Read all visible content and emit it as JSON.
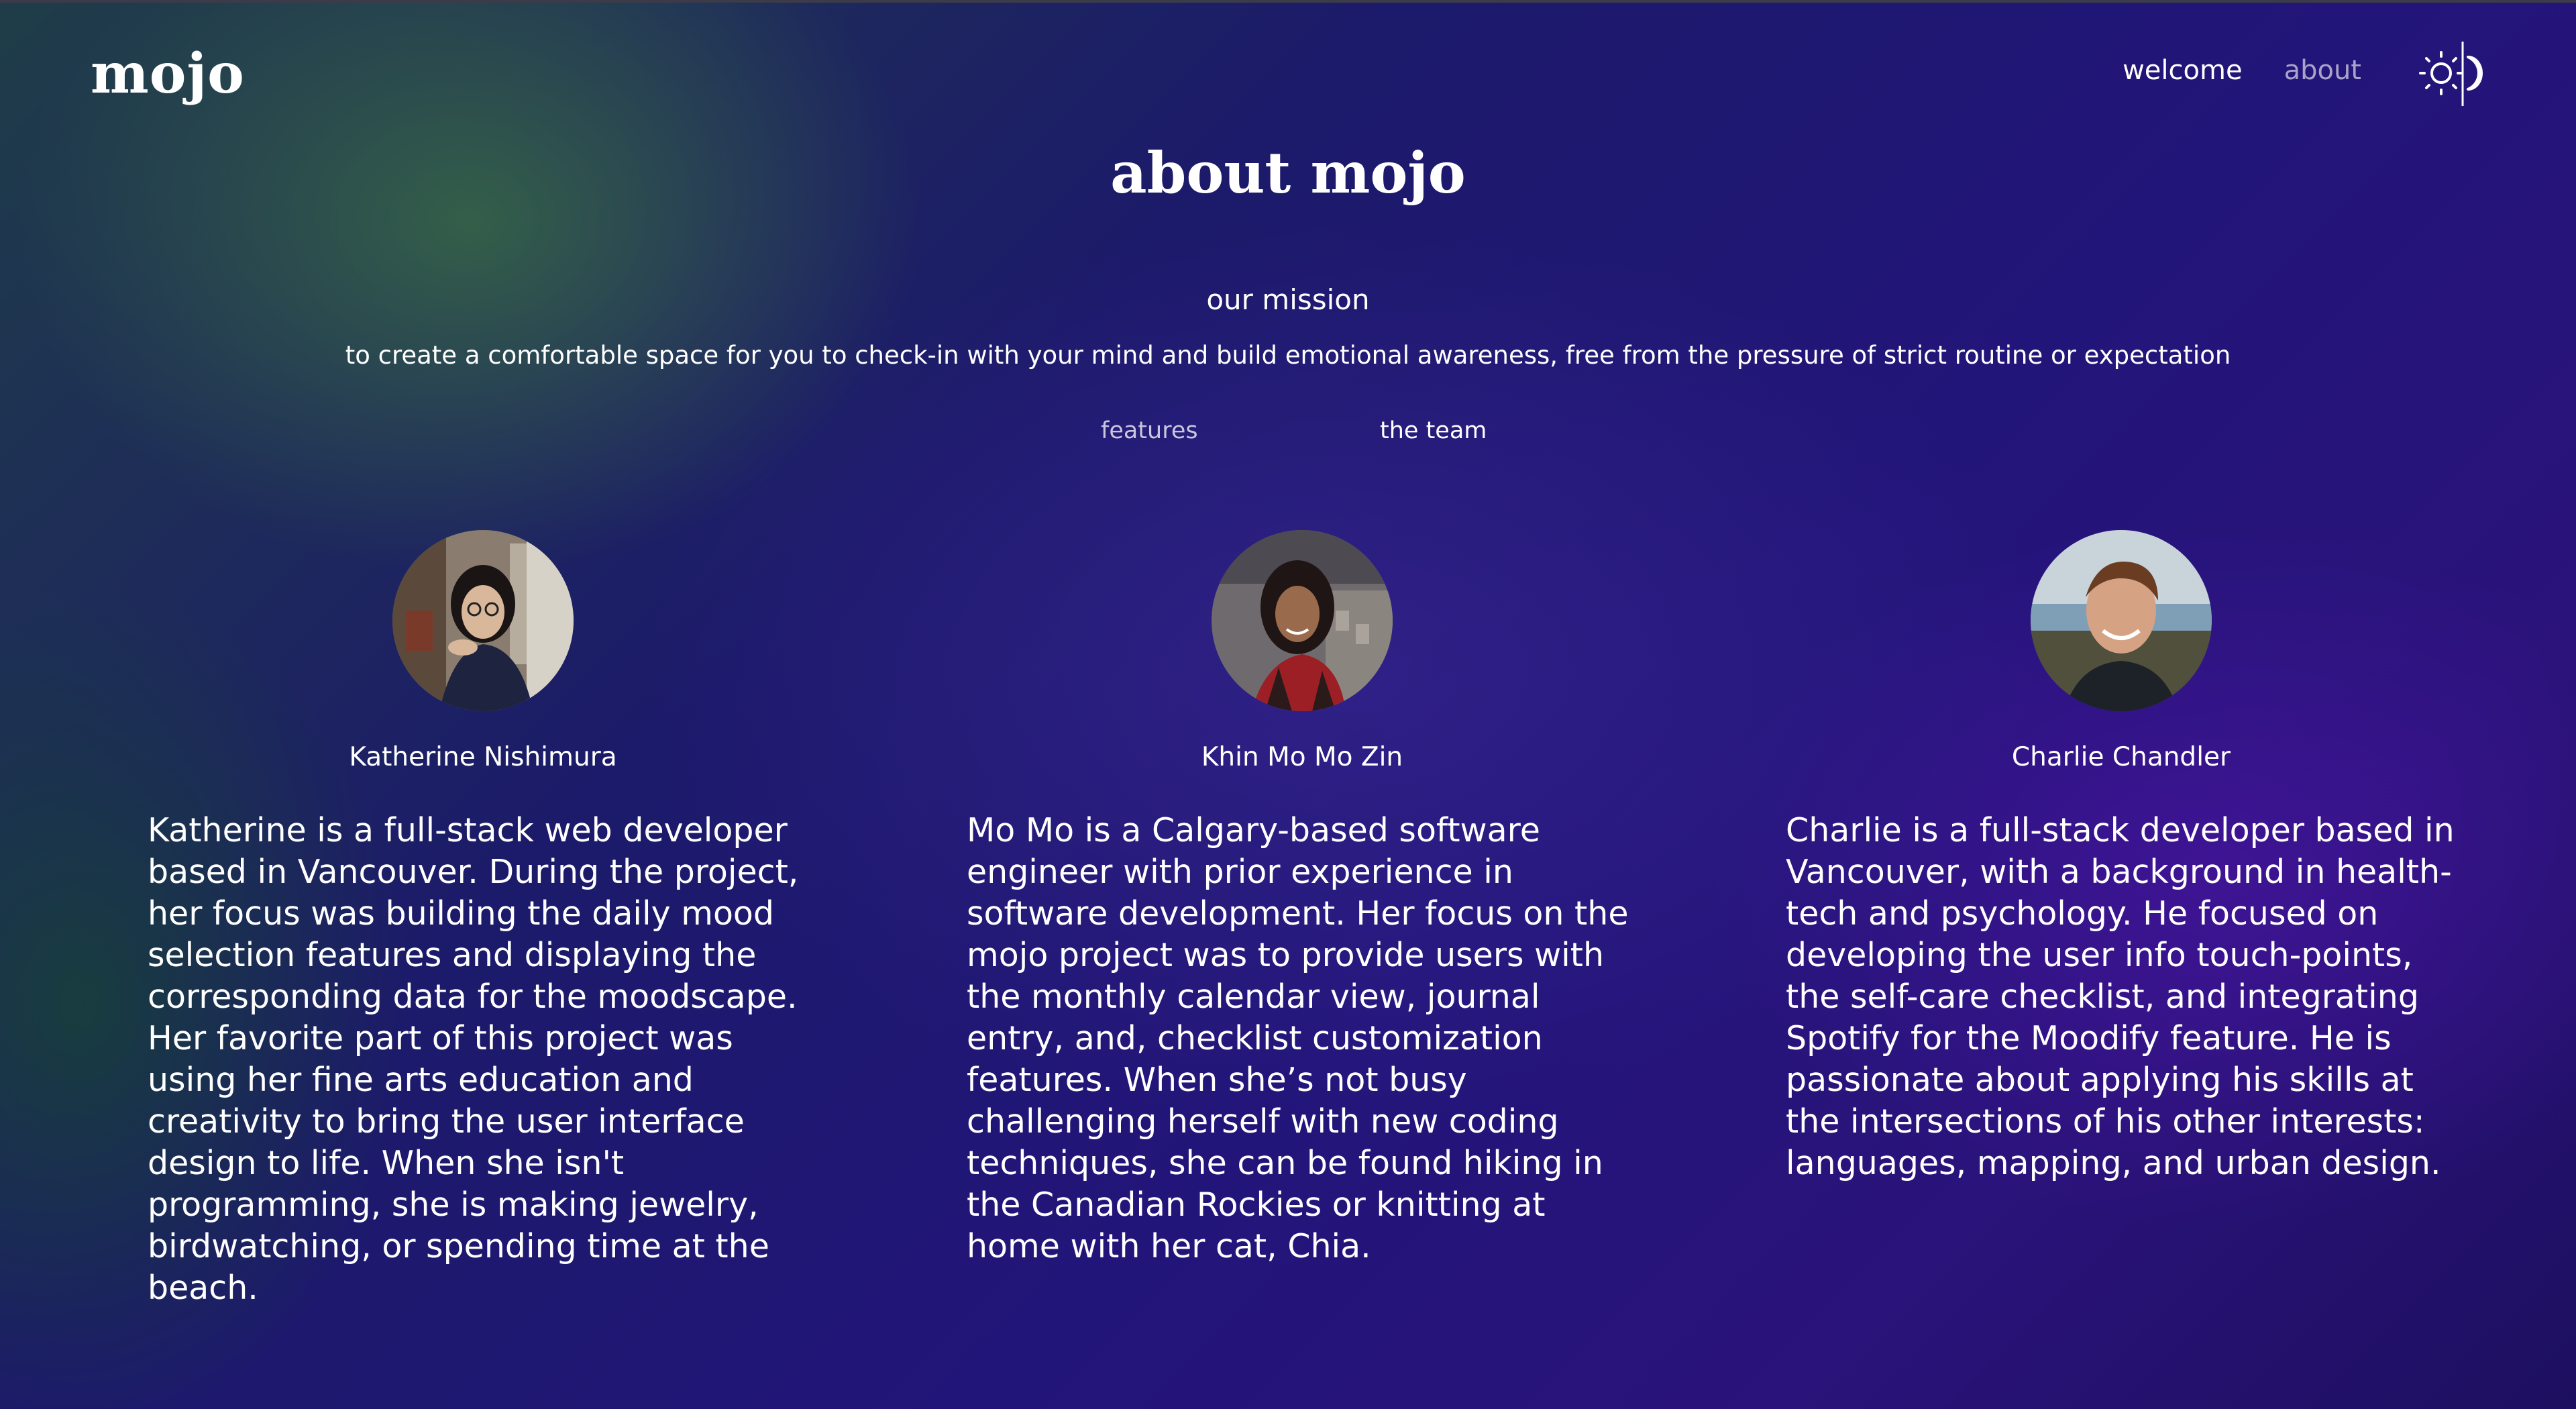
{
  "header": {
    "logo": "mojo",
    "nav": {
      "welcome": "welcome",
      "about": "about"
    },
    "theme_toggle": {
      "icons": [
        "sun-icon",
        "moon-icon"
      ]
    }
  },
  "page": {
    "title": "about mojo",
    "mission_heading": "our mission",
    "mission_text": "to create a comfortable space for you to check-in with your mind and build emotional awareness, free from the pressure of strict routine or expectation"
  },
  "tabs": {
    "features": "features",
    "team": "the team",
    "active": "the team"
  },
  "team": [
    {
      "name": "Katherine Nishimura",
      "bio": "Katherine is a full-stack web developer based in Vancouver. During the project, her focus was building the daily mood selection features and displaying the corresponding data for the moodscape. Her favorite part of this project was using her fine arts education and creativity to bring the user interface design to life. When she isn't programming, she is making jewelry, birdwatching, or spending time at the beach."
    },
    {
      "name": "Khin Mo Mo Zin",
      "bio": "Mo Mo is a Calgary-based software engineer with prior experience in software development. Her focus on the mojo project was to provide users with the monthly calendar view, journal entry, and, checklist customization features. When she’s not busy challenging herself with new coding techniques, she can be found hiking in the Canadian Rockies or knitting at home with her cat, Chia."
    },
    {
      "name": "Charlie Chandler",
      "bio": "Charlie is a full-stack developer based in Vancouver, with a background in health-tech and psychology. He focused on developing the user info touch-points, the self-care checklist, and integrating Spotify for the Moodify feature. He is passionate about applying his skills at the intersections of his other interests: languages, mapping, and urban design."
    }
  ],
  "colors": {
    "text": "#ffffff",
    "muted": "#a8a3c8",
    "bg_green": "#386846",
    "bg_indigo": "#22157a"
  }
}
